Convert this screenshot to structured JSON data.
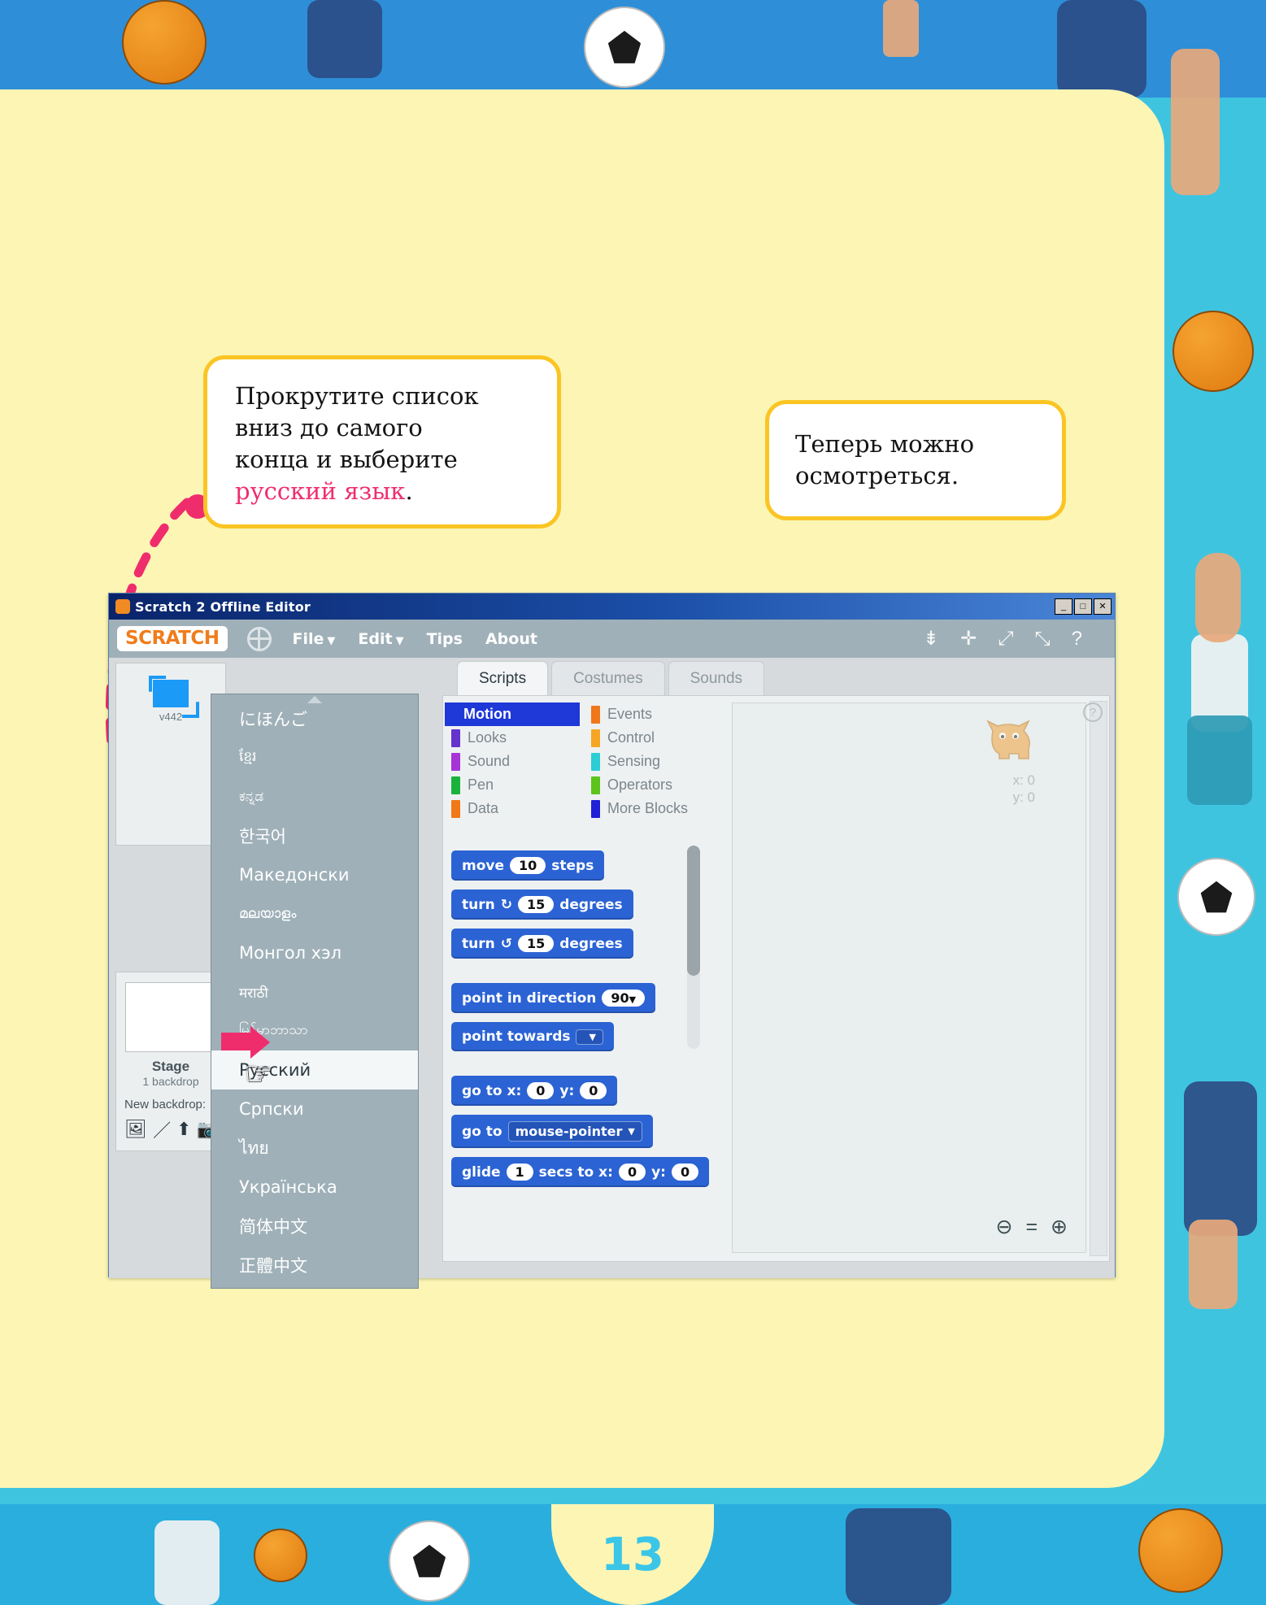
{
  "page": {
    "number": "13",
    "accent": "#3bc6e8",
    "sheet_color": "#fcf5b4"
  },
  "callouts": [
    {
      "id": "bubble-1",
      "line1": "Прокрутите список",
      "line2": "вниз до самого",
      "line3": "конца и выберите",
      "highlight": "русский язык",
      "highlight_color": "#ef2d6d",
      "tail": "."
    },
    {
      "id": "bubble-2",
      "line1": "Теперь можно",
      "line2": "осмотреться."
    }
  ],
  "window": {
    "title": "Scratch 2 Offline Editor",
    "title_icon": "scratch-cat-icon",
    "buttons": {
      "minimize": "_",
      "maximize": "□",
      "close": "✕"
    },
    "menubar": {
      "logo": "SCRATCH",
      "globe_icon": "globe-icon",
      "items": [
        {
          "label": "File",
          "caret": "▼"
        },
        {
          "label": "Edit",
          "caret": "▼"
        },
        {
          "label": "Tips",
          "caret": ""
        },
        {
          "label": "About",
          "caret": ""
        }
      ],
      "tools": [
        {
          "name": "duplicate-icon",
          "glyph": "⇟"
        },
        {
          "name": "cut-icon",
          "glyph": "✛"
        },
        {
          "name": "grow-icon",
          "glyph": "⤢"
        },
        {
          "name": "shrink-icon",
          "glyph": "⤡"
        },
        {
          "name": "help-icon",
          "glyph": "?"
        }
      ]
    },
    "sprite_panel": {
      "sprite_name": "v442"
    },
    "stage_panel": {
      "name": "Stage",
      "backdrop_count": "1 backdrop",
      "new_backdrop_label": "New backdrop:",
      "icons": [
        {
          "name": "library-backdrop-icon",
          "glyph": "🖼"
        },
        {
          "name": "paint-backdrop-icon",
          "glyph": "／"
        },
        {
          "name": "upload-backdrop-icon",
          "glyph": "⬆"
        },
        {
          "name": "camera-backdrop-icon",
          "glyph": "📷"
        }
      ]
    },
    "language_menu": {
      "scroll_up_icon": "scroll-up-arrow",
      "selected": "Русский",
      "items": [
        {
          "label": "にほんご",
          "small": false
        },
        {
          "label": "ខ្មែរ",
          "small": true
        },
        {
          "label": "ಕನ್ನಡ",
          "small": true
        },
        {
          "label": "한국어",
          "small": false
        },
        {
          "label": "Македонски",
          "small": false
        },
        {
          "label": "മലയാളം",
          "small": true
        },
        {
          "label": "Монгол хэл",
          "small": false
        },
        {
          "label": "मराठी",
          "small": true
        },
        {
          "label": "မြန်မာဘာသာ",
          "small": true
        },
        {
          "label": "Русский",
          "small": false
        },
        {
          "label": "Српски",
          "small": false
        },
        {
          "label": "ไทย",
          "small": false
        },
        {
          "label": "Українська",
          "small": false
        },
        {
          "label": "简体中文",
          "small": false
        },
        {
          "label": "正體中文",
          "small": false
        }
      ]
    },
    "tabs": [
      {
        "label": "Scripts",
        "active": true
      },
      {
        "label": "Costumes",
        "active": false
      },
      {
        "label": "Sounds",
        "active": false
      }
    ],
    "categories": [
      {
        "label": "Motion",
        "color": "#1f38d8",
        "active": true
      },
      {
        "label": "Events",
        "color": "#f07818",
        "active": false
      },
      {
        "label": "Looks",
        "color": "#6633cc",
        "active": false
      },
      {
        "label": "Control",
        "color": "#f5a623",
        "active": false
      },
      {
        "label": "Sound",
        "color": "#a634d6",
        "active": false
      },
      {
        "label": "Sensing",
        "color": "#2ccdd4",
        "active": false
      },
      {
        "label": "Pen",
        "color": "#19b33c",
        "active": false
      },
      {
        "label": "Operators",
        "color": "#5cc41b",
        "active": false
      },
      {
        "label": "Data",
        "color": "#f07818",
        "active": false
      },
      {
        "label": "More Blocks",
        "color": "#2020d6",
        "active": false
      }
    ],
    "blocks": [
      {
        "type": "move",
        "pre": "move",
        "value": "10",
        "post": "steps"
      },
      {
        "type": "turn_cw",
        "pre": "turn",
        "icon": "↻",
        "value": "15",
        "post": "degrees"
      },
      {
        "type": "turn_ccw",
        "pre": "turn",
        "icon": "↺",
        "value": "15",
        "post": "degrees"
      },
      {
        "type": "point_direction",
        "pre": "point in direction",
        "value": "90",
        "caret": "▼"
      },
      {
        "type": "point_towards",
        "pre": "point towards",
        "dropdown": "",
        "caret": "▼"
      },
      {
        "type": "goto_xy",
        "pre": "go to x:",
        "x": "0",
        "mid": "y:",
        "y": "0"
      },
      {
        "type": "goto_target",
        "pre": "go to",
        "dropdown": "mouse-pointer",
        "caret": "▼"
      },
      {
        "type": "glide",
        "pre": "glide",
        "secs": "1",
        "mid": "secs to x:",
        "x": "0",
        "mid2": "y:",
        "y": "0"
      }
    ],
    "canvas": {
      "watermark_icon": "scratch-cat-watermark",
      "x_label": "x: 0",
      "y_label": "y: 0",
      "help_badge": "?",
      "zoom": [
        {
          "name": "zoom-out-icon",
          "glyph": "⊖"
        },
        {
          "name": "zoom-reset-icon",
          "glyph": "="
        },
        {
          "name": "zoom-in-icon",
          "glyph": "⊕"
        }
      ]
    }
  }
}
